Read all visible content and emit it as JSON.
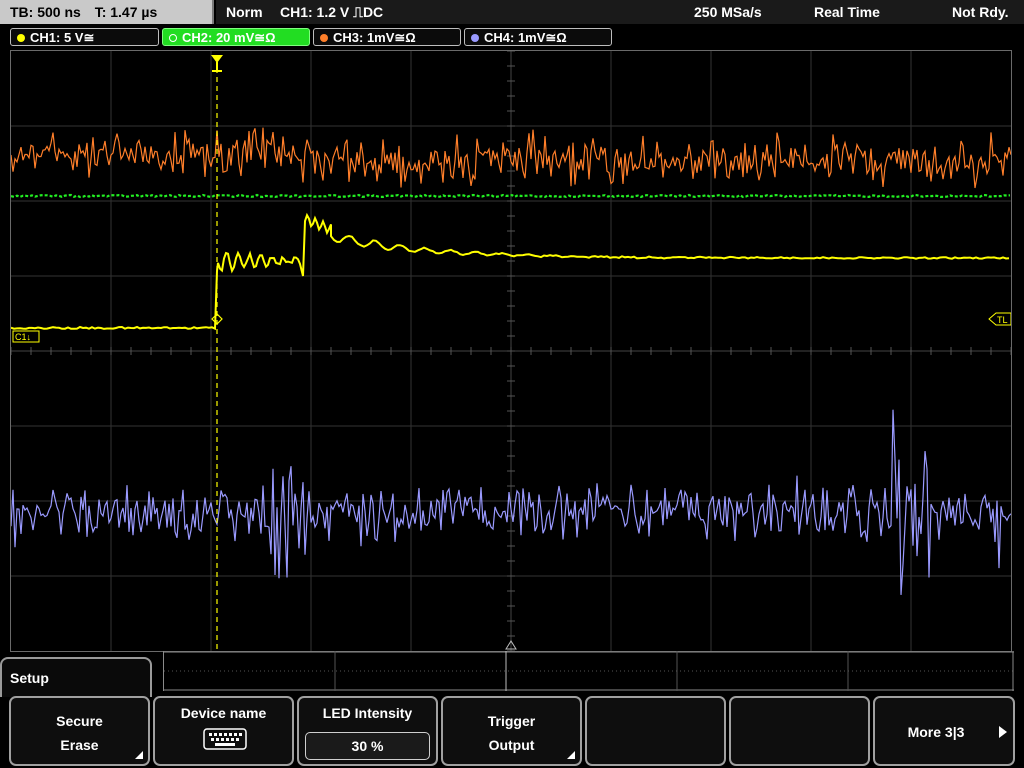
{
  "top": {
    "timebase": "TB: 500 ns",
    "trigger_time": "T: 1.47 µs",
    "mode": "Norm",
    "trigger_info": "CH1: 1.2 V ⎍DC",
    "sample_rate": "250 MSa/s",
    "acq_mode": "Real Time",
    "status": "Not Rdy."
  },
  "channels": [
    {
      "label": "CH1: 5 V≅",
      "color": "#ffff00",
      "active": false
    },
    {
      "label": "CH2: 20 mV≅Ω",
      "color": "#33ff33",
      "active": true
    },
    {
      "label": "CH3: 1mV≅Ω",
      "color": "#ff7f2a",
      "active": false
    },
    {
      "label": "CH4: 1mV≅Ω",
      "color": "#9a9aff",
      "active": false
    }
  ],
  "markers": {
    "ch1": "C1↓",
    "trigger_level": "TL"
  },
  "menu": {
    "title": "Setup",
    "softkeys": [
      {
        "line1": "Secure",
        "line2": "Erase"
      },
      {
        "line1": "Device name",
        "icon": "keyboard-icon"
      },
      {
        "line1": "LED Intensity",
        "value": "30 %"
      },
      {
        "line1": "Trigger",
        "line2": "Output"
      },
      {
        "line1": ""
      },
      {
        "line1": ""
      },
      {
        "line1": "More 3|3"
      }
    ]
  },
  "colors": {
    "ch1": "#ffff00",
    "ch2": "#22ee22",
    "ch3": "#ff7f2a",
    "ch4": "#9a9aff",
    "grid": "#5a5a5a"
  }
}
